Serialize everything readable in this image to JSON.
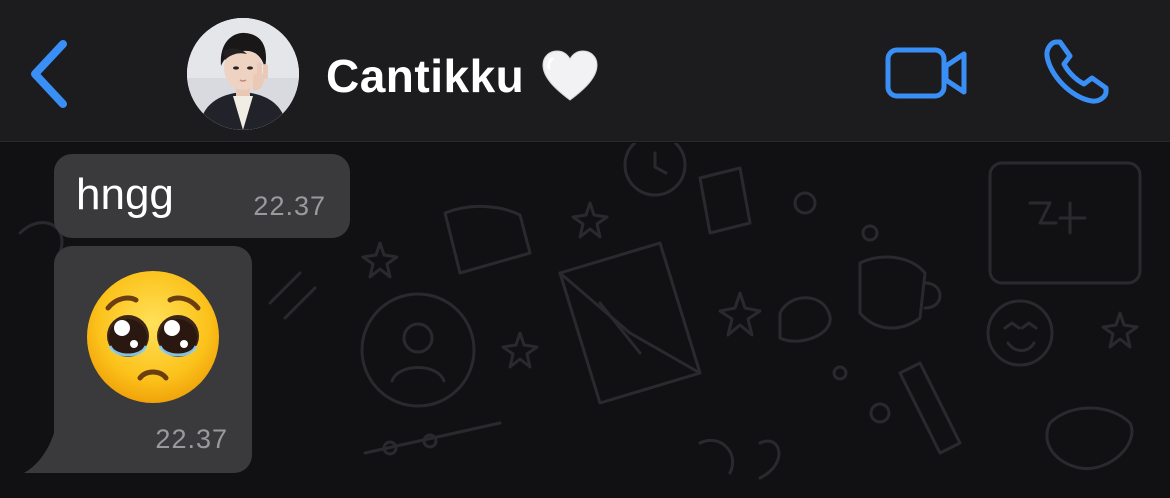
{
  "header": {
    "contact_name": "Cantikku",
    "back_icon": "chevron-left-icon",
    "video_icon": "video-camera-icon",
    "call_icon": "phone-icon",
    "heart_icon": "white-heart-emoji",
    "accent_color": "#3a8ff6"
  },
  "messages": [
    {
      "text": "hngg",
      "time": "22.37"
    },
    {
      "emoji": "pleading-face-emoji",
      "time": "22.37"
    }
  ],
  "colors": {
    "header_bg": "#1c1c1e",
    "bubble_bg": "#3a3a3c",
    "chat_bg": "#111114"
  }
}
